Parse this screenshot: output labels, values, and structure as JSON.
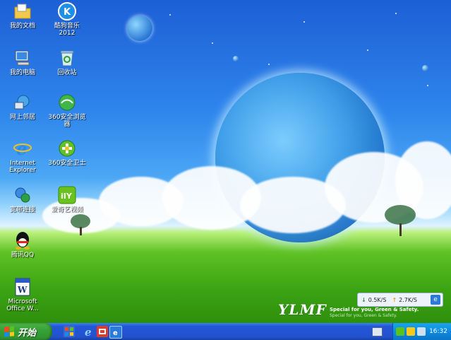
{
  "desktop_icons": [
    {
      "label": "我的文档",
      "icon": "folder-documents-icon"
    },
    {
      "label": "酷狗音乐\n2012",
      "icon": "kugou-music-icon"
    },
    {
      "label": "我的电脑",
      "icon": "my-computer-icon"
    },
    {
      "label": "回收站",
      "icon": "recycle-bin-icon"
    },
    {
      "label": "网上邻居",
      "icon": "network-places-icon"
    },
    {
      "label": "360安全浏览\n器",
      "icon": "360-browser-icon"
    },
    {
      "label": "Internet\nExplorer",
      "icon": "internet-explorer-icon"
    },
    {
      "label": "360安全卫士",
      "icon": "360-safeguard-icon"
    },
    {
      "label": "宽带连接",
      "icon": "broadband-connection-icon"
    },
    {
      "label": "爱奇艺视频",
      "icon": "iqiyi-video-icon"
    },
    {
      "label": "腾讯QQ",
      "icon": "tencent-qq-icon"
    },
    {
      "label": "Microsoft\nOffice W...",
      "icon": "word-icon"
    }
  ],
  "wallpaper": {
    "brand": "YLMF",
    "tagline": "Special for you, Green & Safety.",
    "subtagline": "Special for you, Green & Safety."
  },
  "network_monitor": {
    "download": "0.5K/S",
    "upload": "2.7K/S"
  },
  "taskbar": {
    "start_label": "开始",
    "clock": "16:32"
  },
  "colors": {
    "start_green": "#37a337",
    "taskbar_blue": "#2456d6",
    "tray_blue": "#0c8ae0"
  }
}
